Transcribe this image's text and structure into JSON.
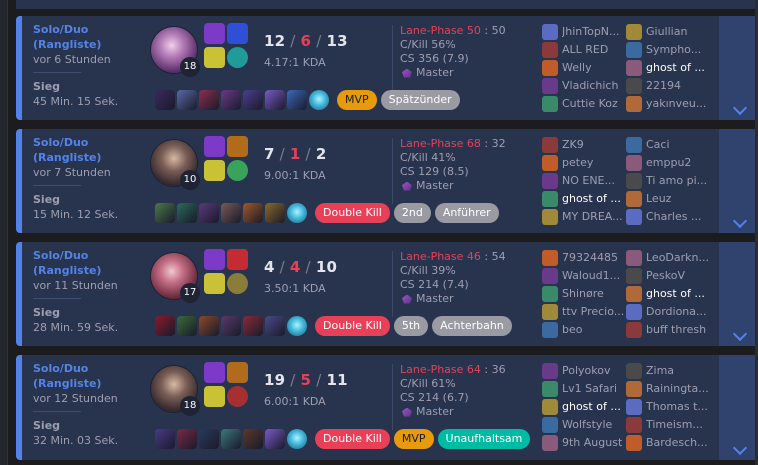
{
  "matches": [
    {
      "queue": "Solo/Duo (Rangliste)",
      "ago": "vor 6 Stunden",
      "result": "Sieg",
      "duration": "45 Min. 15 Sek.",
      "level": "18",
      "kills": "12",
      "deaths": "6",
      "assists": "13",
      "kda_ratio": "4.17:1 KDA",
      "lane_label": "Lane-Phase 50",
      "lane_opp": "50",
      "ckill": "C/Kill 56%",
      "cs": "CS 356 (7.9)",
      "rank": "Master",
      "badges": [
        {
          "text": "MVP",
          "color": "gold"
        },
        {
          "text": "Spätzünder",
          "color": "gray"
        }
      ],
      "team_blue": [
        "JhinTopN...",
        "ALL RED",
        "Welly",
        "Vladichich",
        "Cuttie Koz"
      ],
      "team_red": [
        "Giullian",
        "Sympho...",
        "ghost of ...",
        "22194",
        "yakınveu..."
      ],
      "me_team": "red",
      "me_index": 2
    },
    {
      "queue": "Solo/Duo (Rangliste)",
      "ago": "vor 7 Stunden",
      "result": "Sieg",
      "duration": "15 Min. 12 Sek.",
      "level": "10",
      "kills": "7",
      "deaths": "1",
      "assists": "2",
      "kda_ratio": "9.00:1 KDA",
      "lane_label": "Lane-Phase 68",
      "lane_opp": "32",
      "ckill": "C/Kill 41%",
      "cs": "CS 129 (8.5)",
      "rank": "Master",
      "badges": [
        {
          "text": "Double Kill",
          "color": "red"
        },
        {
          "text": "2nd",
          "color": "gray"
        },
        {
          "text": "Anführer",
          "color": "gray"
        }
      ],
      "team_blue": [
        "ZK9",
        "petey",
        "NO ENE...",
        "ghost of ...",
        "MY DREA..."
      ],
      "team_red": [
        "Caci",
        "emppu2",
        "Ti amo pi...",
        "Leuz",
        "Charles ..."
      ],
      "me_team": "blue",
      "me_index": 3
    },
    {
      "queue": "Solo/Duo (Rangliste)",
      "ago": "vor 11 Stunden",
      "result": "Sieg",
      "duration": "28 Min. 59 Sek.",
      "level": "17",
      "kills": "4",
      "deaths": "4",
      "assists": "10",
      "kda_ratio": "3.50:1 KDA",
      "lane_label": "Lane-Phase 46",
      "lane_opp": "54",
      "ckill": "C/Kill 39%",
      "cs": "CS 214 (7.4)",
      "rank": "Master",
      "badges": [
        {
          "text": "Double Kill",
          "color": "red"
        },
        {
          "text": "5th",
          "color": "gray"
        },
        {
          "text": "Achterbahn",
          "color": "gray"
        }
      ],
      "team_blue": [
        "79324485",
        "Waloud1...",
        "Shinøre",
        "ttv Precio...",
        "beo"
      ],
      "team_red": [
        "LeoDarkn...",
        "PeskoV",
        "ghost of ...",
        "Dordiona...",
        "buff thresh"
      ],
      "me_team": "red",
      "me_index": 2
    },
    {
      "queue": "Solo/Duo (Rangliste)",
      "ago": "vor 12 Stunden",
      "result": "Sieg",
      "duration": "32 Min. 03 Sek.",
      "level": "18",
      "kills": "19",
      "deaths": "5",
      "assists": "11",
      "kda_ratio": "6.00:1 KDA",
      "lane_label": "Lane-Phase 64",
      "lane_opp": "36",
      "ckill": "C/Kill 61%",
      "cs": "CS 214 (6.7)",
      "rank": "Master",
      "badges": [
        {
          "text": "Double Kill",
          "color": "red"
        },
        {
          "text": "MVP",
          "color": "gold"
        },
        {
          "text": "Unaufhaltsam",
          "color": "green"
        }
      ],
      "team_blue": [
        "Polyokov",
        "Lv1 Safari",
        "ghost of ...",
        "Wolfstyle",
        "9th August"
      ],
      "team_red": [
        "Zima",
        "Rainingta...",
        "Thomas t...",
        "Timeism...",
        "Bardesch..."
      ],
      "me_team": "blue",
      "me_index": 2
    }
  ],
  "colors": {
    "win_accent": "#5383e8",
    "panel": "#28344e",
    "death_red": "#e84057"
  },
  "icons": {
    "expand": "chevron-down-icon",
    "rank": "master-emblem-icon"
  }
}
